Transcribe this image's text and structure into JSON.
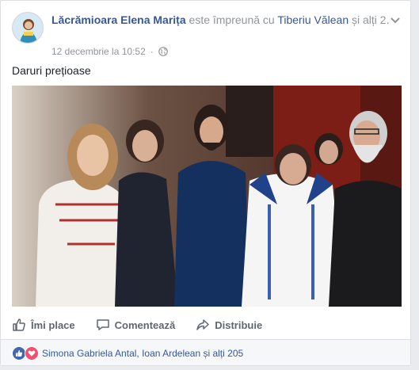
{
  "post": {
    "author": "Lăcrămioara Elena Marița",
    "with_text": " este împreună cu ",
    "tagged": "Tiberiu Vălean",
    "tail_text": " și alți 2.",
    "timestamp": "12 decembrie la 10:52",
    "audience_icon": "globe-icon",
    "text": "Daruri prețioase"
  },
  "actions": {
    "like": "Îmi place",
    "comment": "Comentează",
    "share": "Distribuie"
  },
  "footer": {
    "reaction_icons": [
      "like-icon",
      "love-icon"
    ],
    "likers": "Simona Gabriela Antal, Ioan Ardelean și alți 205"
  },
  "colors": {
    "link": "#365899",
    "like": "#4267b2",
    "love": "#f0506e",
    "muted": "#90949c"
  }
}
